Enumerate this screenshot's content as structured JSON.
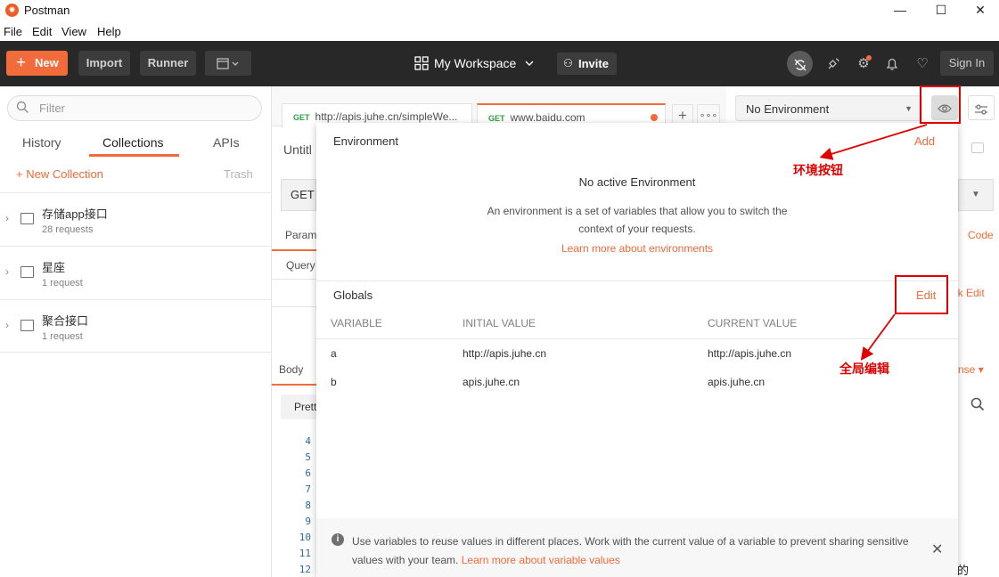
{
  "app": {
    "title": "Postman",
    "logo": "postman-logo-icon"
  },
  "menu": [
    "File",
    "Edit",
    "View",
    "Help"
  ],
  "header": {
    "new_label": "New",
    "import_label": "Import",
    "runner_label": "Runner",
    "workspace_label": "My Workspace",
    "invite_label": "Invite",
    "signin_label": "Sign In",
    "accent_color": "#f26b3a"
  },
  "sidebar": {
    "filter_placeholder": "Filter",
    "tabs": [
      "History",
      "Collections",
      "APIs"
    ],
    "active_tab": "Collections",
    "new_collection": "+ New Collection",
    "trash": "Trash",
    "collections": [
      {
        "name": "存储app接口",
        "count": "28 requests"
      },
      {
        "name": "星座",
        "count": "1 request"
      },
      {
        "name": "聚合接口",
        "count": "1 request"
      }
    ]
  },
  "request_tabs": [
    {
      "method": "GET",
      "url": "http://apis.juhe.cn/simpleWe..."
    },
    {
      "method": "GET",
      "url": "www.baidu.com"
    }
  ],
  "background": {
    "untitled": "Untitl",
    "method": "GET",
    "params": "Param",
    "query": "Query",
    "code": "Code",
    "bulk_edit": "lk Edit",
    "body": "Body",
    "pretty": "Prett",
    "response": "nse",
    "line_numbers": [
      "4",
      "5",
      "6",
      "7",
      "8",
      "9",
      "10",
      "11",
      "12"
    ],
    "truncated_char": "的"
  },
  "environment": {
    "selected": "No Environment",
    "panel_title": "Environment",
    "add_label": "Add",
    "no_active": "No active Environment",
    "description_line1": "An environment is a set of variables that allow you to switch the",
    "description_line2": "context of your requests.",
    "learn_more": "Learn more about environments"
  },
  "globals": {
    "title": "Globals",
    "edit_label": "Edit",
    "columns": [
      "VARIABLE",
      "INITIAL VALUE",
      "CURRENT VALUE"
    ],
    "rows": [
      {
        "variable": "a",
        "initial": "http://apis.juhe.cn",
        "current": "http://apis.juhe.cn"
      },
      {
        "variable": "b",
        "initial": "apis.juhe.cn",
        "current": "apis.juhe.cn"
      }
    ]
  },
  "footer": {
    "text": "Use variables to reuse values in different places. Work with the current value of a variable to prevent sharing sensitive values with your team.",
    "link": "Learn more about variable values"
  },
  "annotations": {
    "env_button": "环境按钮",
    "global_edit": "全局编辑",
    "color": "#e00000"
  }
}
